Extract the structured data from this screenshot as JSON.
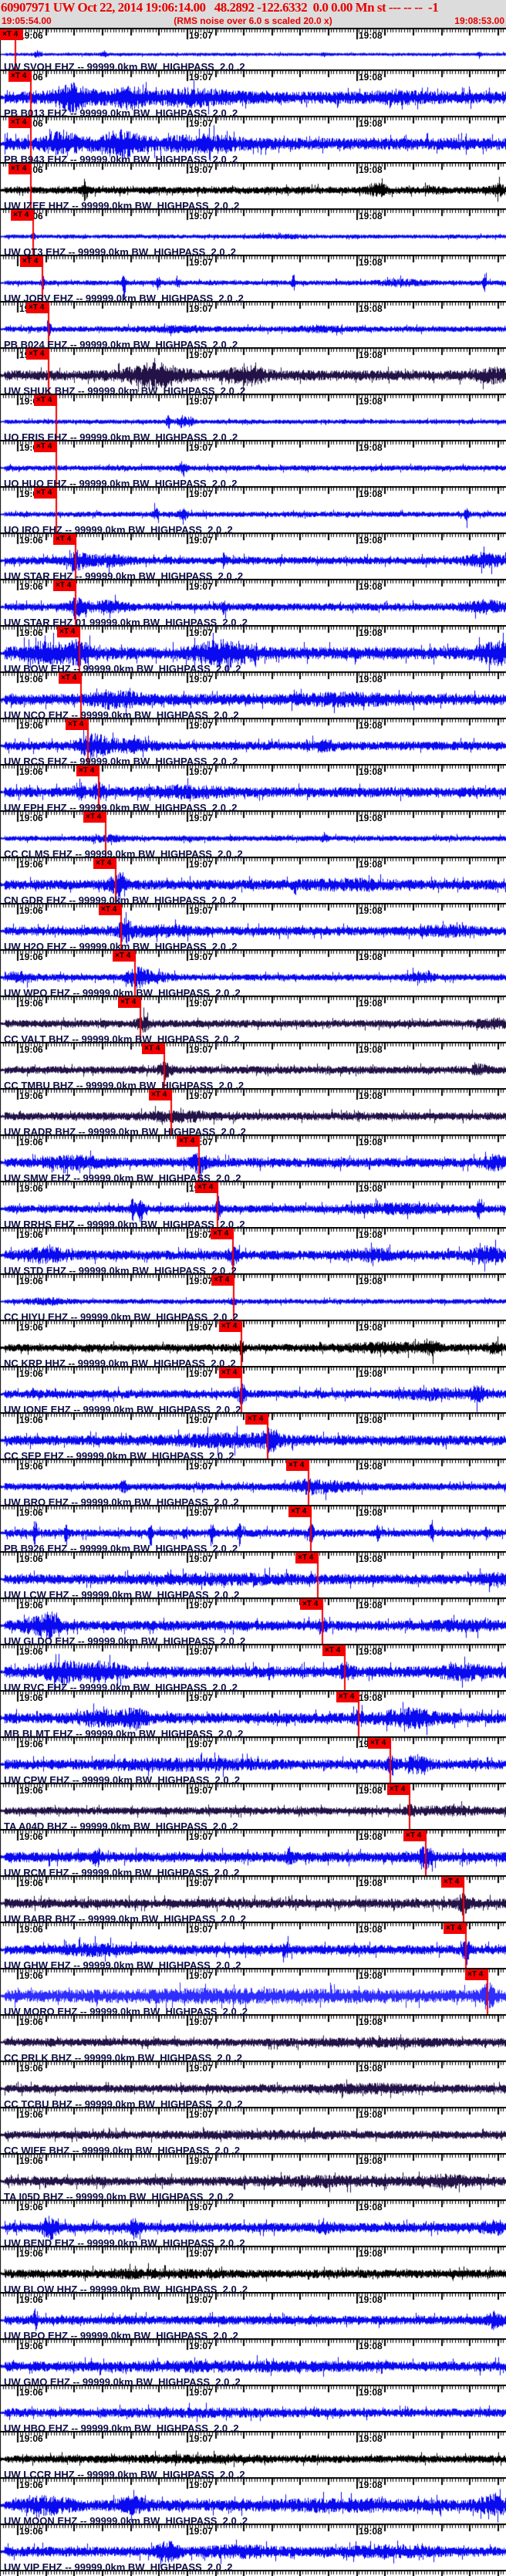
{
  "header": {
    "title": "60907971 UW Oct 22, 2014 19:06:14.00   48.2892 -122.6332  0.0 0.00 Mn st --- -- --  -1",
    "start_time": "19:05:54.00",
    "note": "(RMS noise over 6.0 s scaled 20.0 x)",
    "end_time": "19:08:53.00"
  },
  "ruler": {
    "minute_labels": [
      "19:06",
      "19:07",
      "19:08"
    ],
    "minute_tick_x": [
      22,
      242,
      462
    ],
    "window_seconds": 179
  },
  "pick": {
    "flag_text": "×T 4"
  },
  "colors": {
    "blue": "#0a0af0",
    "bright": "#2e2eff",
    "navy": "#221247",
    "black": "#000000",
    "red": "#f40000",
    "label_text": "#0d0d45",
    "time_label": "#000000",
    "header_bg": "#dcdcdc",
    "header_text": "#e80000"
  },
  "rows": [
    {
      "label": "UW SVOH EHZ -- 99999.0km BW  HIGHPASS  2.0 .2",
      "color": "blue",
      "pick": 20,
      "amp": 0.1,
      "bursts": [
        [
          48,
          4,
          2.5
        ],
        [
          135,
          4,
          1.5
        ],
        [
          420,
          3,
          1.2
        ],
        [
          620,
          3,
          1.4
        ]
      ]
    },
    {
      "label": "PB B013 EHZ -- 99999.0km BW  HIGHPASS  2.0 .2",
      "color": "blue",
      "pick": 40,
      "amp": 0.5,
      "bursts": [
        [
          95,
          25,
          1.6
        ],
        [
          165,
          22,
          1.2
        ],
        [
          250,
          45,
          0.8
        ],
        [
          520,
          40,
          0.3
        ]
      ]
    },
    {
      "label": "PB B943 EHZ -- 99999.0km BW  HIGHPASS  2.0 .2",
      "color": "blue",
      "pick": 40,
      "amp": 0.5,
      "bursts": [
        [
          80,
          20,
          1.3
        ],
        [
          155,
          30,
          1.5
        ],
        [
          260,
          45,
          0.8
        ]
      ]
    },
    {
      "label": "UW IZEE HHZ -- 99999.0km BW  HIGHPASS  2.0 .2",
      "color": "black",
      "pick": 40,
      "amp": 0.28,
      "bursts": [
        [
          110,
          3,
          3.0
        ],
        [
          490,
          12,
          1.4
        ],
        [
          560,
          8,
          0.8
        ],
        [
          645,
          10,
          1.2
        ]
      ]
    },
    {
      "label": "UW QT3 EHZ -- 99999.0km BW  HIGHPASS  2.0 .2",
      "color": "blue",
      "pick": 43,
      "amp": 0.14,
      "bursts": [
        [
          365,
          30,
          0.6
        ],
        [
          43,
          3,
          1.2
        ]
      ]
    },
    {
      "label": "UW JORV EHZ -- 99999.0km BW  HIGHPASS  2.0 .2",
      "color": "blue",
      "pick": 55,
      "amp": 0.18,
      "bursts": [
        [
          55,
          2,
          3.0
        ],
        [
          160,
          2,
          4.0
        ],
        [
          205,
          2,
          3.0
        ],
        [
          230,
          2,
          3.0
        ],
        [
          380,
          2,
          4.0
        ],
        [
          520,
          30,
          0.9
        ],
        [
          628,
          2,
          4.0
        ]
      ]
    },
    {
      "label": "PB B024 EHZ -- 99999.0km BW  HIGHPASS  2.0 .2",
      "color": "blue",
      "pick": 63,
      "amp": 0.22,
      "bursts": [
        [
          63,
          3,
          2.0
        ],
        [
          230,
          40,
          0.6
        ],
        [
          410,
          30,
          0.5
        ]
      ]
    },
    {
      "label": "UW SHUK BHZ -- 99999.0km BW  HIGHPASS  2.0 .2",
      "color": "navy",
      "pick": 63,
      "amp": 0.42,
      "bursts": [
        [
          200,
          35,
          1.8
        ],
        [
          320,
          25,
          1.2
        ],
        [
          640,
          20,
          0.8
        ]
      ]
    },
    {
      "label": "UO FRIS EHZ -- 99999.0km BW  HIGHPASS  2.0 .2",
      "color": "blue",
      "pick": 73,
      "amp": 0.16,
      "bursts": [
        [
          218,
          3,
          3.0
        ],
        [
          236,
          6,
          2.8
        ],
        [
          246,
          4,
          2.0
        ]
      ]
    },
    {
      "label": "UO HUO EHZ -- 99999.0km BW  HIGHPASS  2.0 .2",
      "color": "blue",
      "pick": 73,
      "amp": 0.2,
      "bursts": [
        [
          237,
          5,
          2.2
        ]
      ]
    },
    {
      "label": "UO IRO EHZ -- 99999.0km BW  HIGHPASS  2.0 .2",
      "color": "blue",
      "pick": 73,
      "amp": 0.2,
      "bursts": [
        [
          202,
          3,
          2.5
        ],
        [
          237,
          5,
          2.2
        ],
        [
          605,
          3,
          2.5
        ]
      ]
    },
    {
      "label": "UW STAR EHZ -- 99999.0km BW  HIGHPASS  2.0 .2",
      "color": "blue",
      "pick": 98,
      "amp": 0.3,
      "bursts": [
        [
          100,
          12,
          2.0
        ],
        [
          140,
          25,
          1.0
        ],
        [
          290,
          3,
          1.5
        ],
        [
          628,
          25,
          1.2
        ]
      ]
    },
    {
      "label": "UW STAR EHZ 01 99999.0km BW  HIGHPASS  2.0 .2",
      "color": "blue",
      "pick": 98,
      "amp": 0.3,
      "bursts": [
        [
          100,
          12,
          2.0
        ],
        [
          140,
          25,
          1.0
        ],
        [
          290,
          3,
          1.5
        ],
        [
          628,
          25,
          1.2
        ]
      ]
    },
    {
      "label": "UW BOW EHZ -- 99999.0km BW  HIGHPASS  2.0 .2",
      "color": "blue",
      "pick": 103,
      "amp": 0.5,
      "bursts": [
        [
          60,
          30,
          1.2
        ],
        [
          103,
          15,
          1.5
        ],
        [
          290,
          35,
          1.5
        ],
        [
          645,
          25,
          1.3
        ]
      ]
    },
    {
      "label": "UW NCO EHZ -- 99999.0km BW  HIGHPASS  2.0 .2",
      "color": "blue",
      "pick": 105,
      "amp": 0.45,
      "bursts": [
        [
          150,
          30,
          1.0
        ],
        [
          450,
          60,
          0.5
        ]
      ]
    },
    {
      "label": "UW RCS EHZ -- 99999.0km BW  HIGHPASS  2.0 .2",
      "color": "blue",
      "pick": 114,
      "amp": 0.35,
      "bursts": [
        [
          120,
          18,
          2.2
        ],
        [
          165,
          30,
          1.0
        ],
        [
          420,
          15,
          0.8
        ]
      ]
    },
    {
      "label": "UW EPH EHZ -- 99999.0km BW  HIGHPASS  2.0 .2",
      "color": "blue",
      "pick": 128,
      "amp": 0.4,
      "bursts": [
        [
          105,
          4,
          1.8
        ],
        [
          128,
          6,
          1.5
        ],
        [
          240,
          50,
          0.6
        ]
      ]
    },
    {
      "label": "CC CLMS EHZ -- 99999.0km BW  HIGHPASS  2.0 .2",
      "color": "blue",
      "pick": 137,
      "amp": 0.2,
      "bursts": [
        [
          140,
          25,
          0.8
        ],
        [
          420,
          4,
          1.0
        ]
      ]
    },
    {
      "label": "CN GDR EHZ -- 99999.0km BW  HIGHPASS  2.0 .2",
      "color": "blue",
      "pick": 150,
      "amp": 0.4,
      "bursts": [
        [
          152,
          10,
          1.8
        ],
        [
          450,
          60,
          0.5
        ]
      ]
    },
    {
      "label": "UW H2O EHZ -- 99999.0km BW  HIGHPASS  2.0 .2",
      "color": "blue",
      "pick": 157,
      "amp": 0.35,
      "bursts": [
        [
          162,
          8,
          1.8
        ],
        [
          200,
          50,
          0.7
        ],
        [
          580,
          40,
          0.6
        ]
      ]
    },
    {
      "label": "UW WPO EHZ -- 99999.0km BW  HIGHPASS  2.0 .2",
      "color": "blue",
      "pick": 175,
      "amp": 0.25,
      "bursts": [
        [
          25,
          20,
          1.2
        ],
        [
          176,
          12,
          2.0
        ],
        [
          195,
          25,
          1.4
        ],
        [
          545,
          15,
          1.2
        ]
      ]
    },
    {
      "label": "CC VALT BHZ -- 99999.0km BW  HIGHPASS  2.0 .2",
      "color": "navy",
      "pick": 182,
      "amp": 0.3,
      "bursts": [
        [
          185,
          8,
          1.5
        ],
        [
          640,
          20,
          0.8
        ]
      ]
    },
    {
      "label": "CC TMBU BHZ -- 99999.0km BW  HIGHPASS  2.0 .2",
      "color": "navy",
      "pick": 213,
      "amp": 0.3,
      "bursts": [
        [
          215,
          8,
          2.0
        ],
        [
          620,
          10,
          0.8
        ]
      ]
    },
    {
      "label": "UW RADR BHZ -- 99999.0km BW  HIGHPASS  2.0 .2",
      "color": "navy",
      "pick": 222,
      "amp": 0.32,
      "bursts": [
        [
          230,
          40,
          0.8
        ]
      ]
    },
    {
      "label": "UW SMW EHZ -- 99999.0km BW  HIGHPASS  2.0 .2",
      "color": "blue",
      "pick": 258,
      "amp": 0.38,
      "bursts": [
        [
          100,
          40,
          0.8
        ],
        [
          258,
          10,
          1.6
        ],
        [
          640,
          15,
          1.0
        ]
      ]
    },
    {
      "label": "UW RRHS EHZ -- 99999.0km BW  HIGHPASS  2.0 .2",
      "color": "blue",
      "pick": 282,
      "amp": 0.3,
      "bursts": [
        [
          172,
          3,
          3.0
        ],
        [
          182,
          3,
          4.0
        ],
        [
          283,
          3,
          3.0
        ],
        [
          510,
          60,
          0.8
        ],
        [
          620,
          3,
          2.5
        ]
      ]
    },
    {
      "label": "UW STD EHZ -- 99999.0km BW  HIGHPASS  2.0 .2",
      "color": "blue",
      "pick": 302,
      "amp": 0.38,
      "bursts": [
        [
          60,
          30,
          1.0
        ],
        [
          302,
          6,
          1.5
        ],
        [
          480,
          30,
          0.8
        ],
        [
          630,
          20,
          1.2
        ]
      ]
    },
    {
      "label": "CC HIYU EHZ -- 99999.0km BW  HIGHPASS  2.0 .2",
      "color": "blue",
      "pick": 303,
      "amp": 0.18,
      "bursts": [
        [
          60,
          25,
          1.0
        ],
        [
          303,
          4,
          1.2
        ]
      ]
    },
    {
      "label": "NC KRP HHZ -- 99999.0km BW  HIGHPASS  2.0 .2",
      "color": "black",
      "pick": 313,
      "amp": 0.3,
      "bursts": [
        [
          313,
          4,
          1.5
        ],
        [
          500,
          50,
          0.8
        ],
        [
          560,
          8,
          1.5
        ],
        [
          640,
          8,
          1.2
        ]
      ]
    },
    {
      "label": "UW IONE EHZ -- 99999.0km BW  HIGHPASS  2.0 .2",
      "color": "blue",
      "pick": 313,
      "amp": 0.33,
      "bursts": [
        [
          313,
          6,
          1.8
        ],
        [
          560,
          40,
          0.7
        ],
        [
          620,
          10,
          1.5
        ]
      ]
    },
    {
      "label": "CC SEP EHZ -- 99999.0km BW  HIGHPASS  2.0 .2",
      "color": "blue",
      "pick": 347,
      "amp": 0.4,
      "bursts": [
        [
          300,
          80,
          0.7
        ],
        [
          350,
          10,
          1.2
        ]
      ]
    },
    {
      "label": "UW BRO EHZ -- 99999.0km BW  HIGHPASS  2.0 .2",
      "color": "blue",
      "pick": 400,
      "amp": 0.28,
      "bursts": [
        [
          160,
          4,
          1.5
        ],
        [
          400,
          20,
          1.2
        ],
        [
          430,
          40,
          0.8
        ]
      ]
    },
    {
      "label": "PB B926 EHZ -- 99999.0km BW  HIGHPASS  2.0 .2",
      "color": "blue",
      "pick": 403,
      "amp": 0.3,
      "bursts": [
        [
          45,
          2,
          4.0
        ],
        [
          85,
          2,
          3.0
        ],
        [
          195,
          2,
          3.5
        ],
        [
          240,
          2,
          2.5
        ],
        [
          275,
          2,
          4.0
        ],
        [
          310,
          2,
          3.0
        ],
        [
          403,
          3,
          2.5
        ],
        [
          490,
          2,
          3.0
        ],
        [
          560,
          2,
          3.5
        ],
        [
          630,
          2,
          3.0
        ]
      ]
    },
    {
      "label": "UW LCW EHZ -- 99999.0km BW  HIGHPASS  2.0 .2",
      "color": "blue",
      "pick": 412,
      "amp": 0.4,
      "bursts": [
        [
          300,
          100,
          0.4
        ],
        [
          640,
          20,
          0.6
        ]
      ]
    },
    {
      "label": "UW GLDO EHZ -- 99999.0km BW  HIGHPASS  2.0 .2",
      "color": "blue",
      "pick": 418,
      "amp": 0.4,
      "bursts": [
        [
          45,
          20,
          1.0
        ],
        [
          65,
          10,
          1.8
        ],
        [
          418,
          6,
          1.0
        ],
        [
          600,
          40,
          0.5
        ]
      ]
    },
    {
      "label": "UW RVC EHZ -- 99999.0km BW  HIGHPASS  2.0 .2",
      "color": "blue",
      "pick": 447,
      "amp": 0.45,
      "bursts": [
        [
          80,
          25,
          1.2
        ],
        [
          130,
          30,
          1.1
        ],
        [
          447,
          8,
          1.3
        ],
        [
          600,
          30,
          0.8
        ]
      ]
    },
    {
      "label": "MB BLMT EHZ -- 99999.0km BW  HIGHPASS  2.0 .2",
      "color": "blue",
      "pick": 465,
      "amp": 0.42,
      "bursts": [
        [
          130,
          30,
          1.0
        ],
        [
          175,
          15,
          1.2
        ],
        [
          465,
          6,
          1.0
        ],
        [
          530,
          35,
          1.3
        ]
      ]
    },
    {
      "label": "UW CPW EHZ -- 99999.0km BW  HIGHPASS  2.0 .2",
      "color": "blue",
      "pick": 506,
      "amp": 0.4,
      "bursts": [
        [
          240,
          100,
          0.5
        ],
        [
          506,
          6,
          1.5
        ],
        [
          540,
          15,
          1.2
        ]
      ]
    },
    {
      "label": "TA A04D BHZ -- 99999.0km BW  HIGHPASS  2.0 .2",
      "color": "navy",
      "pick": 531,
      "amp": 0.3,
      "bursts": [
        [
          531,
          5,
          1.5
        ],
        [
          580,
          40,
          0.6
        ]
      ]
    },
    {
      "label": "UW RCM EHZ -- 99999.0km BW  HIGHPASS  2.0 .2",
      "color": "blue",
      "pick": 552,
      "amp": 0.42,
      "bursts": [
        [
          125,
          4,
          1.5
        ],
        [
          375,
          5,
          1.2
        ],
        [
          552,
          8,
          1.6
        ]
      ]
    },
    {
      "label": "UW BABR BHZ -- 99999.0km BW  HIGHPASS  2.0 .2",
      "color": "navy",
      "pick": 601,
      "amp": 0.38,
      "bursts": [
        [
          601,
          8,
          1.5
        ],
        [
          700,
          30,
          0.8
        ]
      ]
    },
    {
      "label": "UW GHW EHZ -- 99999.0km BW  HIGHPASS  2.0 .2",
      "color": "blue",
      "pick": 604,
      "amp": 0.38,
      "bursts": [
        [
          120,
          40,
          0.6
        ],
        [
          370,
          5,
          1.0
        ],
        [
          604,
          6,
          1.6
        ]
      ]
    },
    {
      "label": "UW MORO EHZ -- 99999.0km BW  HIGHPASS  2.0 .2",
      "color": "bright",
      "pick": 632,
      "amp": 0.52,
      "bursts": [
        [
          300,
          150,
          0.3
        ],
        [
          632,
          8,
          1.4
        ]
      ]
    },
    {
      "label": "CC PRLK BHZ -- 99999.0km BW  HIGHPASS  2.0 .2",
      "color": "navy",
      "pick": null,
      "amp": 0.32,
      "bursts": [
        [
          500,
          80,
          0.4
        ]
      ]
    },
    {
      "label": "CC TCBU BHZ -- 99999.0km BW  HIGHPASS  2.0 .2",
      "color": "navy",
      "pick": null,
      "amp": 0.32,
      "bursts": [
        [
          480,
          60,
          0.5
        ]
      ]
    },
    {
      "label": "CC WIFE BHZ -- 99999.0km BW  HIGHPASS  2.0 .2",
      "color": "navy",
      "pick": null,
      "amp": 0.32,
      "bursts": [
        [
          350,
          100,
          0.3
        ]
      ]
    },
    {
      "label": "TA I05D BHZ -- 99999.0km BW  HIGHPASS  2.0 .2",
      "color": "navy",
      "pick": null,
      "amp": 0.36,
      "bursts": [
        [
          420,
          80,
          0.5
        ],
        [
          580,
          30,
          0.8
        ]
      ]
    },
    {
      "label": "UW BEND EHZ -- 99999.0km BW  HIGHPASS  2.0 .2",
      "color": "blue",
      "pick": null,
      "amp": 0.38,
      "bursts": [
        [
          65,
          10,
          1.8
        ],
        [
          175,
          8,
          1.2
        ],
        [
          420,
          6,
          1.2
        ],
        [
          640,
          15,
          1.0
        ]
      ]
    },
    {
      "label": "UW BLOW HHZ -- 99999.0km BW  HIGHPASS  2.0 .2",
      "color": "black",
      "pick": null,
      "amp": 0.34,
      "bursts": [
        [
          200,
          60,
          0.4
        ]
      ]
    },
    {
      "label": "UW BPO EHZ -- 99999.0km BW  HIGHPASS  2.0 .2",
      "color": "blue",
      "pick": null,
      "amp": 0.36,
      "bursts": [
        [
          45,
          3,
          2.0
        ],
        [
          640,
          8,
          1.5
        ]
      ]
    },
    {
      "label": "UW GMO EHZ -- 99999.0km BW  HIGHPASS  2.0 .2",
      "color": "blue",
      "pick": null,
      "amp": 0.4,
      "bursts": [
        [
          300,
          150,
          0.3
        ]
      ]
    },
    {
      "label": "UW HBO EHZ -- 99999.0km BW  HIGHPASS  2.0 .2",
      "color": "blue",
      "pick": null,
      "amp": 0.34,
      "bursts": [
        [
          250,
          100,
          0.3
        ]
      ]
    },
    {
      "label": "UW LCCR HHZ -- 99999.0km BW  HIGHPASS  2.0 .2",
      "color": "black",
      "pick": null,
      "amp": 0.3,
      "bursts": [
        [
          250,
          100,
          0.3
        ]
      ]
    },
    {
      "label": "UW MOON EHZ -- 99999.0km BW  HIGHPASS  2.0 .2",
      "color": "blue",
      "pick": null,
      "amp": 0.45,
      "bursts": [
        [
          60,
          30,
          1.0
        ],
        [
          170,
          20,
          0.8
        ],
        [
          450,
          100,
          0.4
        ],
        [
          640,
          20,
          1.2
        ]
      ]
    },
    {
      "label": "UW VIP EHZ -- 99999.0km BW  HIGHPASS  2.0 .2",
      "color": "blue",
      "pick": null,
      "amp": 0.4,
      "bursts": [
        [
          218,
          12,
          1.8
        ],
        [
          310,
          40,
          0.6
        ],
        [
          500,
          60,
          0.5
        ]
      ]
    }
  ]
}
